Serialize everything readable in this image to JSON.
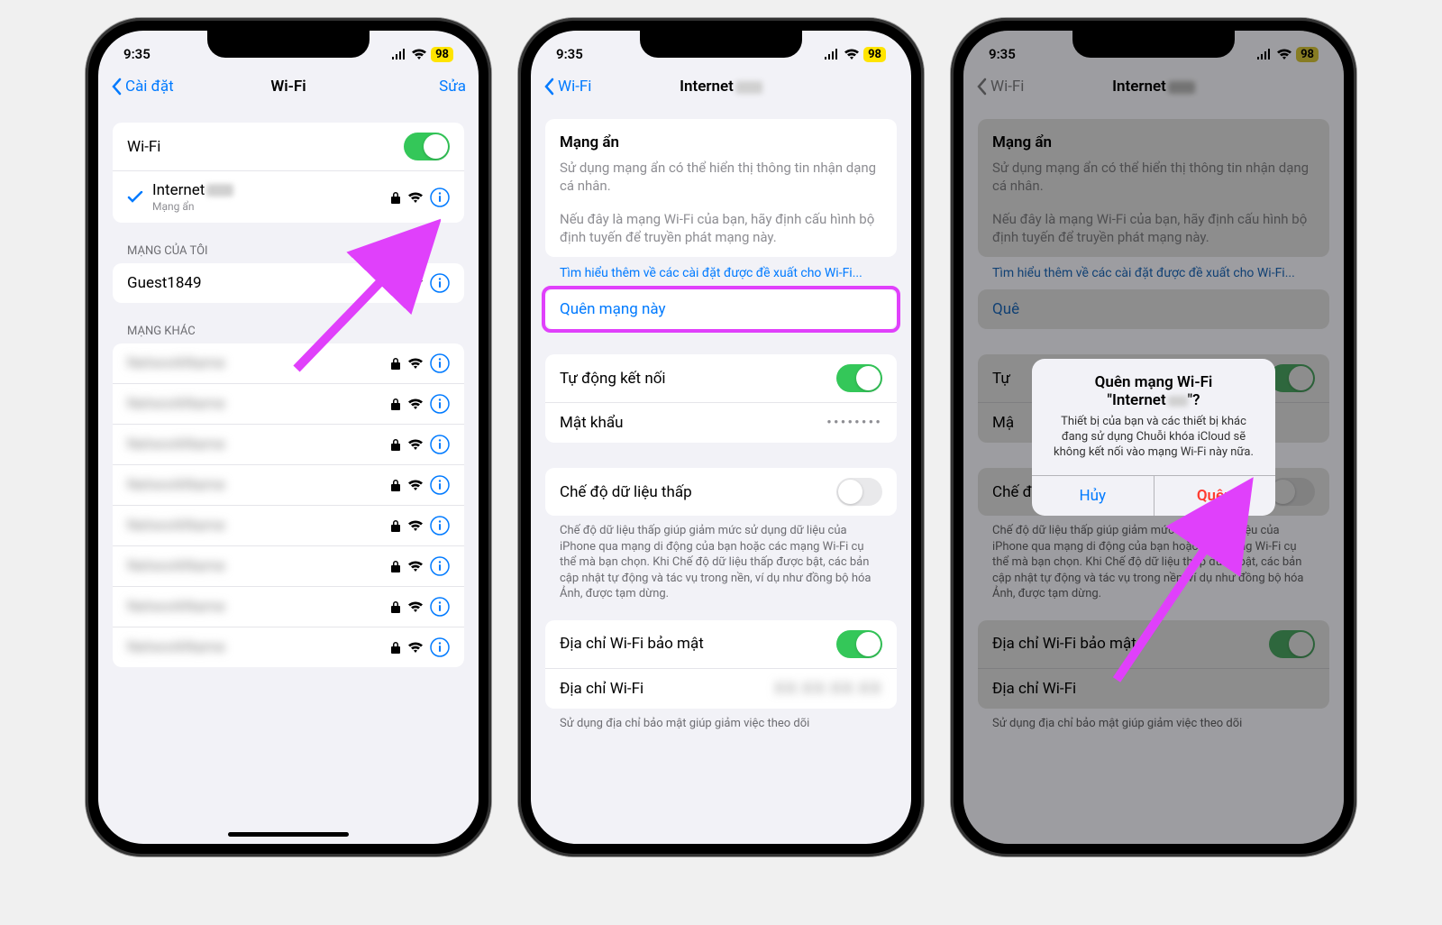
{
  "status": {
    "time": "9:35",
    "battery": "98"
  },
  "screen1": {
    "nav": {
      "back": "Cài đặt",
      "title": "Wi-Fi",
      "action": "Sửa"
    },
    "wifi_row": "Wi-Fi",
    "connected": {
      "name": "Internet",
      "sub": "Mạng ẩn"
    },
    "my_networks_header": "MẠNG CỦA TÔI",
    "my_networks": [
      {
        "name": "Guest1849"
      }
    ],
    "other_header": "MẠNG KHÁC",
    "other_networks": [
      "",
      "",
      "",
      "",
      "",
      "",
      "",
      ""
    ]
  },
  "screen2": {
    "nav": {
      "back": "Wi-Fi",
      "title": "Internet"
    },
    "hidden": {
      "title": "Mạng ẩn",
      "desc1": "Sử dụng mạng ẩn có thể hiển thị thông tin nhận dạng cá nhân.",
      "desc2": "Nếu đây là mạng Wi-Fi của bạn, hãy định cấu hình bộ định tuyến để truyền phát mạng này."
    },
    "learn_more": "Tìm hiểu thêm về các cài đặt được đề xuất cho Wi-Fi...",
    "forget": "Quên mạng này",
    "auto_join": "Tự động kết nối",
    "password_label": "Mật khẩu",
    "password_value": "••••••••",
    "low_data": "Chế độ dữ liệu thấp",
    "low_data_desc": "Chế độ dữ liệu thấp giúp giảm mức sử dụng dữ liệu của iPhone qua mạng di động của bạn hoặc các mạng Wi-Fi cụ thể mà bạn chọn. Khi Chế độ dữ liệu thấp được bật, các bản cập nhật tự động và tác vụ trong nền, ví dụ như đồng bộ hóa Ảnh, được tạm dừng.",
    "private_addr": "Địa chỉ Wi-Fi bảo mật",
    "wifi_addr": "Địa chỉ Wi-Fi",
    "addr_desc": "Sử dụng địa chỉ bảo mật giúp giảm việc theo dõi"
  },
  "screen3": {
    "nav": {
      "back": "Wi-Fi",
      "title": "Internet"
    },
    "forget_short": "Quê",
    "auto_short": "Tự",
    "pw_short": "Mậ",
    "alert": {
      "title_l1": "Quên mạng Wi-Fi",
      "title_l2": "\"Internet",
      "title_suffix": "\"?",
      "msg": "Thiết bị của bạn và các thiết bị khác đang sử dụng Chuỗi khóa iCloud sẽ không kết nối vào mạng Wi-Fi này nữa.",
      "cancel": "Hủy",
      "confirm": "Quên"
    }
  }
}
